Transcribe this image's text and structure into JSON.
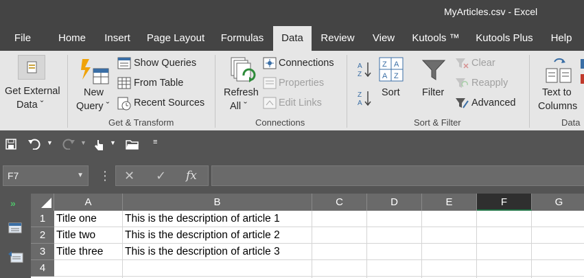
{
  "window": {
    "title": "MyArticles.csv  -  Excel"
  },
  "tabs": [
    "File",
    "Home",
    "Insert",
    "Page Layout",
    "Formulas",
    "Data",
    "Review",
    "View",
    "Kutools ™",
    "Kutools Plus",
    "Help"
  ],
  "active_tab": "Data",
  "ribbon": {
    "get_external": {
      "line1": "Get External",
      "line2": "Data ˇ"
    },
    "new_query": {
      "line1": "New",
      "line2": "Query ˇ"
    },
    "show_queries": "Show Queries",
    "from_table": "From Table",
    "recent_sources": "Recent Sources",
    "get_transform": "Get & Transform",
    "refresh": {
      "line1": "Refresh",
      "line2": "All ˇ"
    },
    "connections": "Connections",
    "properties": "Properties",
    "edit_links": "Edit Links",
    "connections_group": "Connections",
    "sort": "Sort",
    "filter": "Filter",
    "clear": "Clear",
    "reapply": "Reapply",
    "advanced": "Advanced",
    "sort_filter_group": "Sort & Filter",
    "text_to_columns": {
      "line1": "Text to",
      "line2": "Columns"
    },
    "data_group": "Data"
  },
  "formula_bar": {
    "name_box": "F7",
    "fx": "fx",
    "value": ""
  },
  "sheet": {
    "columns": [
      "A",
      "B",
      "C",
      "D",
      "E",
      "F",
      "G"
    ],
    "selected_column": "F",
    "rows": [
      {
        "num": "1",
        "a": "Title one",
        "b": "This is the description of article 1"
      },
      {
        "num": "2",
        "a": "Title two",
        "b": "This is the description of article 2"
      },
      {
        "num": "3",
        "a": "Title three",
        "b": "This is the description of article 3"
      },
      {
        "num": "4",
        "a": "",
        "b": ""
      }
    ]
  },
  "colors": {
    "accent": "#217346",
    "titlebar": "#444444",
    "ribbon": "#e6e6e6"
  }
}
